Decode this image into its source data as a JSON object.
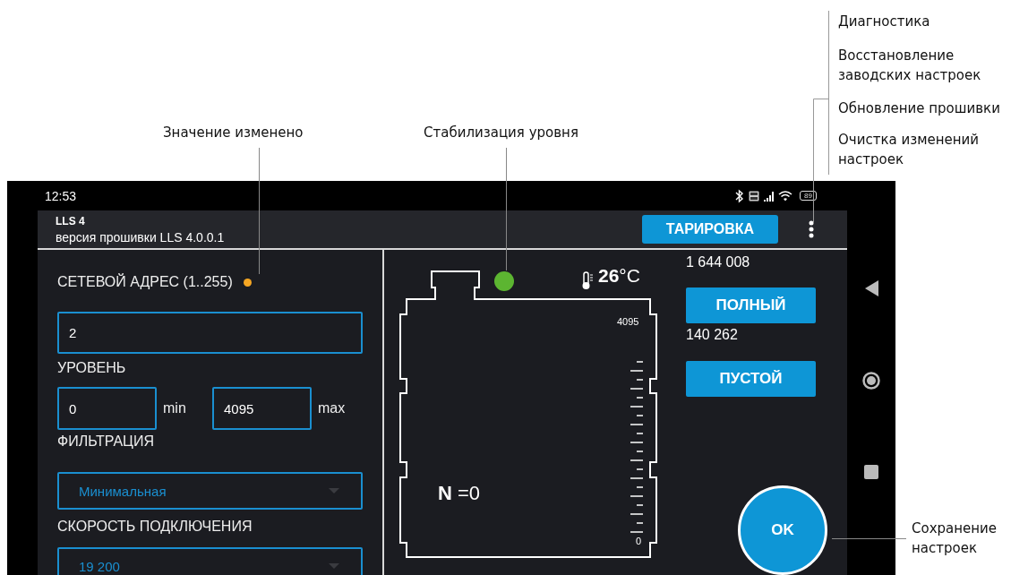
{
  "callouts": [
    {
      "text": "Значение изменено"
    },
    {
      "text": "Стабилизация уровня"
    },
    {
      "text": "Сохранение настроек"
    }
  ],
  "menu_callout": {
    "items": [
      "Диагностика",
      "Восстановление заводских настроек",
      "Обновление прошивки",
      "Очистка изменений настроек"
    ]
  },
  "status_bar": {
    "time": "12:53",
    "battery": "89"
  },
  "header": {
    "device": "LLS 4",
    "firmware": "версия прошивки LLS 4.0.0.1",
    "calibrate_button": "ТАРИРОВКА"
  },
  "settings": [
    {
      "kind": "input",
      "label": "СЕТЕВОЙ АДРЕС (1..255)",
      "changed": true,
      "value": "2"
    },
    {
      "kind": "range",
      "label": "УРОВЕНЬ",
      "changed": false,
      "min_value": "0",
      "min_unit": "min",
      "max_value": "4095",
      "max_unit": "max"
    },
    {
      "kind": "select",
      "label": "ФИЛЬТРАЦИЯ",
      "changed": false,
      "value": "Минимальная"
    },
    {
      "kind": "select",
      "label": "СКОРОСТЬ ПОДКЛЮЧЕНИЯ",
      "changed": false,
      "value": "19 200"
    }
  ],
  "tank": {
    "stable": true,
    "temperature": "**26**°C",
    "scale_max": "4095",
    "scale_min": "0",
    "reading": "**N** =0"
  },
  "calibration": {
    "full_value": "1 644 008",
    "full_button": "ПОЛНЫЙ",
    "empty_value": "140 262",
    "empty_button": "ПУСТОЙ"
  },
  "ok_button": "OK"
}
